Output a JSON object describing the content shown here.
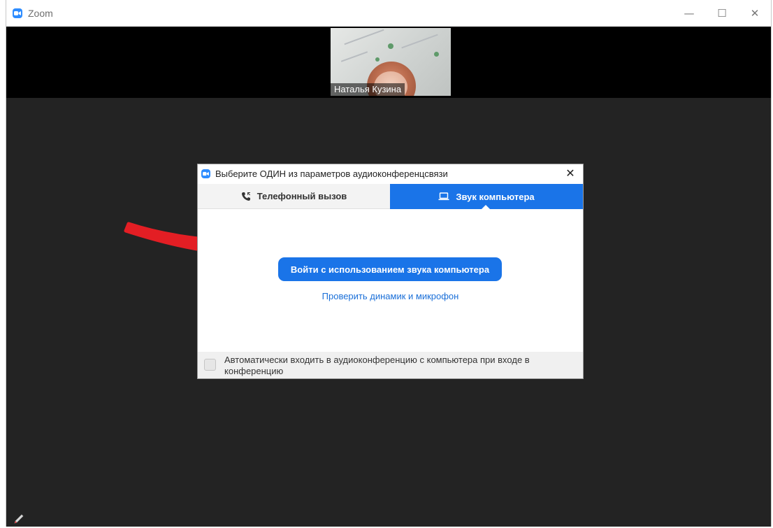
{
  "window": {
    "title": "Zoom",
    "controls": {
      "minimize": "—",
      "maximize": "☐",
      "close": "✕"
    }
  },
  "video": {
    "participant_name": "Наталья Кузина"
  },
  "dialog": {
    "title": "Выберите ОДИН из параметров аудиоконференцсвязи",
    "close": "✕",
    "tabs": [
      {
        "label": "Телефонный вызов",
        "icon": "phone-icon",
        "active": false
      },
      {
        "label": "Звук компьютера",
        "icon": "laptop-icon",
        "active": true
      }
    ],
    "join_button": "Войти с использованием звука компьютера",
    "test_link": "Проверить динамик и микрофон",
    "auto_join_checkbox": {
      "label": "Автоматически входить в аудиоконференцию с компьютера при входе в конференцию",
      "checked": false
    }
  },
  "annotation": {
    "arrow_color": "#e31e24"
  },
  "colors": {
    "accent": "#1a74e8",
    "background": "#232323"
  }
}
